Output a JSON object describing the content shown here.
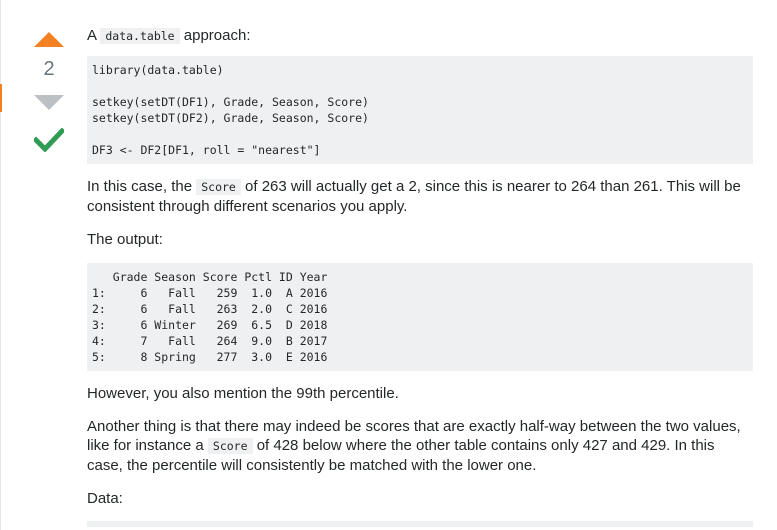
{
  "vote": {
    "count": "2"
  },
  "answer": {
    "intro_prefix": "A ",
    "intro_code": "data.table",
    "intro_suffix": " approach:",
    "code1": "library(data.table)\n\nsetkey(setDT(DF1), Grade, Season, Score)\nsetkey(setDT(DF2), Grade, Season, Score)\n\nDF3 <- DF2[DF1, roll = \"nearest\"]",
    "para1_a": "In this case, the ",
    "para1_code": "Score",
    "para1_b": " of 263 will actually get a 2, since this is nearer to 264 than 261. This will be consistent through different scenarios you apply.",
    "output_label": "The output:",
    "code2": "   Grade Season Score Pctl ID Year\n1:     6   Fall   259  1.0  A 2016\n2:     6   Fall   263  2.0  C 2016\n3:     6 Winter   269  6.5  D 2018\n4:     7   Fall   264  9.0  B 2017\n5:     8 Spring   277  3.0  E 2016",
    "para2": "However, you also mention the 99th percentile.",
    "para3_a": "Another thing is that there may indeed be scores that are exactly half-way between the two values, like for instance a ",
    "para3_code": "Score",
    "para3_b": " of 428 below where the other table contains only 427 and 429. In this case, the percentile will consistently be matched with the lower one.",
    "data_label": "Data:",
    "code3": ""
  },
  "colors": {
    "upvote_active": "#f48024",
    "downvote": "#bbc0c4",
    "accepted_check": "#2f9c54",
    "code_bg": "#eff0f1"
  },
  "icons": {
    "upvote": "upvote-arrow-icon",
    "downvote": "downvote-arrow-icon",
    "accepted": "accepted-check-icon"
  }
}
